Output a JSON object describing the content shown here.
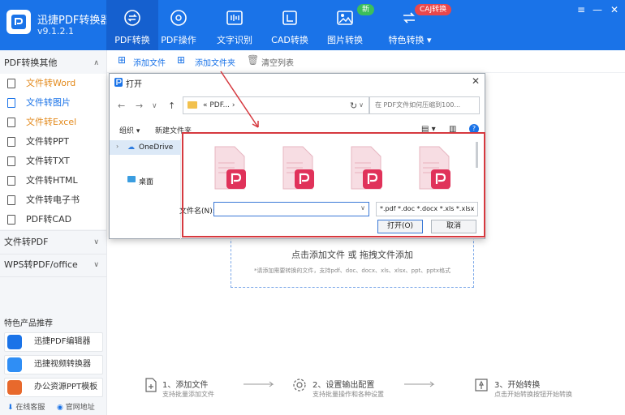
{
  "app": {
    "name": "迅捷PDF转换器",
    "version": "v9.1.2.1"
  },
  "nav": {
    "tabs": [
      {
        "label": "PDF转换"
      },
      {
        "label": "PDF操作"
      },
      {
        "label": "文字识别"
      },
      {
        "label": "CAD转换"
      },
      {
        "label": "图片转换",
        "badge": "新"
      },
      {
        "label": "特色转换 ▾",
        "badge": "CAJ转换"
      }
    ]
  },
  "window": {
    "menu": "≡",
    "minimize": "—",
    "close": "✕"
  },
  "sidebar": {
    "group1": {
      "label": "PDF转换其他",
      "arrow": "∧"
    },
    "items": [
      {
        "label": "文件转Word"
      },
      {
        "label": "文件转图片"
      },
      {
        "label": "文件转Excel"
      },
      {
        "label": "文件转PPT"
      },
      {
        "label": "文件转TXT"
      },
      {
        "label": "文件转HTML"
      },
      {
        "label": "文件转电子书"
      },
      {
        "label": "PDF转CAD"
      }
    ],
    "group2": {
      "label": "文件转PDF",
      "arrow": "∨"
    },
    "group3": {
      "label": "WPS转PDF/office",
      "arrow": "∨"
    },
    "promo_title": "特色产品推荐",
    "promos": [
      {
        "label": "迅捷PDF编辑器"
      },
      {
        "label": "迅捷视频转换器"
      },
      {
        "label": "办公资源PPT模板"
      }
    ],
    "footer": {
      "service": "在线客服",
      "website": "官网地址"
    }
  },
  "toolbar": {
    "add_file": "添加文件",
    "add_folder": "添加文件夹",
    "clear": "清空列表"
  },
  "dropzone": {
    "title": "点击添加文件 或 拖拽文件添加",
    "subtitle": "*请添加需要转换的文件，支持pdf、doc、docx、xls、xlsx、ppt、pptx格式"
  },
  "steps": [
    {
      "title": "1、添加文件",
      "desc": "支持批量添加文件"
    },
    {
      "title": "2、设置输出配置",
      "desc": "支持批量操作和各种设置"
    },
    {
      "title": "3、开始转换",
      "desc": "点击开始转换按钮开始转换"
    }
  ],
  "dialog": {
    "title": "打开",
    "address": "« PDF... ›",
    "search_placeholder": "在 PDF文件如何压缩到100...",
    "organize": "组织 ▾",
    "new_folder": "新建文件夹",
    "tree": {
      "onedrive": "OneDrive",
      "desktop": "桌面"
    },
    "filename_label": "文件名(N):",
    "filename_value": "",
    "filetype": "*.pdf *.doc *.docx *.xls *.xlsx",
    "open_button": "打开(O)",
    "cancel_button": "取消"
  },
  "colors": {
    "brand": "#1a73e8",
    "highlight": "#e38a1c",
    "pdf_red": "#e0325a",
    "annotation": "#d6393f"
  }
}
